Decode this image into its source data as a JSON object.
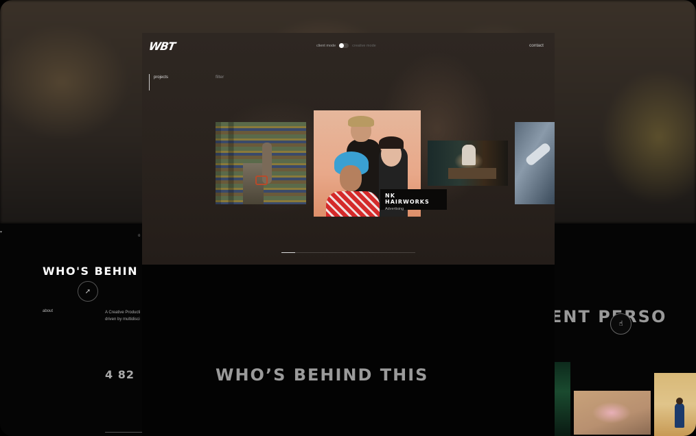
{
  "main": {
    "logo": "WBT",
    "mode": {
      "client_label": "client mode",
      "creative_label": "creative mode",
      "selected": "client mode"
    },
    "contact": "contact",
    "nav": {
      "projects": "projects",
      "filter": "filter"
    },
    "featured": {
      "title": "NK HAIRWORKS",
      "category": "Advertising"
    },
    "progress": 0.1
  },
  "background_left": {
    "heading": "WHO'S BEHIN",
    "about_label": "about",
    "description_line1": "A Creative Producti",
    "description_line2": "driven by multidisci",
    "stat": "4 82"
  },
  "background_right": {
    "heading": "ENT PERSO"
  },
  "center": {
    "heading": "WHO’S BEHIND THIS"
  }
}
